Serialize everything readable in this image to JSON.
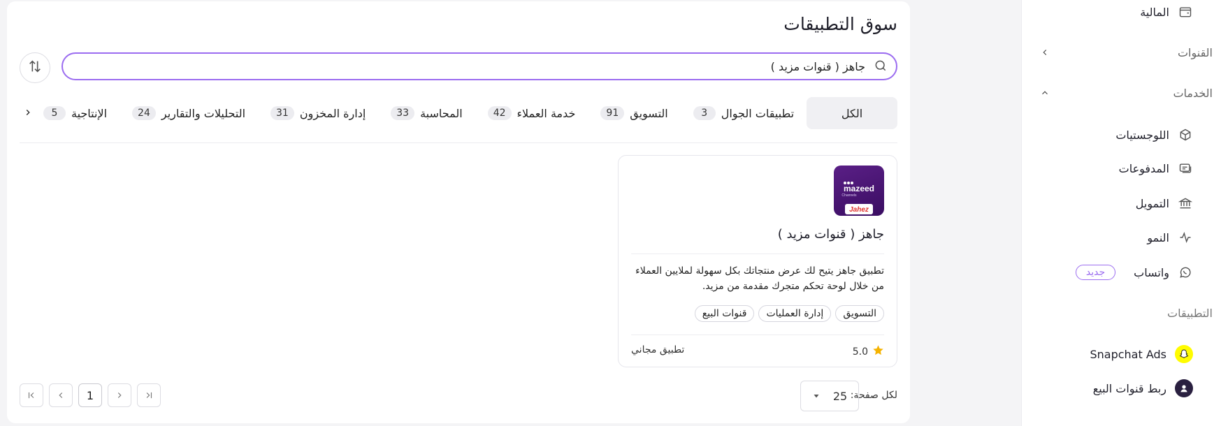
{
  "sidebar": {
    "finance": "المالية",
    "channels": "القنوات",
    "services": "الخدمات",
    "items": [
      {
        "label": "اللوجستيات",
        "icon": "box-icon"
      },
      {
        "label": "المدفوعات",
        "icon": "card-icon"
      },
      {
        "label": "التمويل",
        "icon": "bank-icon"
      },
      {
        "label": "النمو",
        "icon": "activity-icon"
      },
      {
        "label": "واتساب",
        "icon": "whatsapp-icon"
      }
    ],
    "new_badge": "جديد",
    "apps_section": "التطبيقات",
    "apps": [
      {
        "label": "Snapchat Ads",
        "icon": "snapchat-icon"
      },
      {
        "label": "ربط قنوات البيع",
        "icon": "sales-channel-icon"
      }
    ]
  },
  "main": {
    "title": "سوق التطبيقات",
    "search_value": "جاهز ( قنوات مزيد )",
    "categories": [
      {
        "label": "الكل",
        "count": ""
      },
      {
        "label": "تطبيقات الجوال",
        "count": "3"
      },
      {
        "label": "التسويق",
        "count": "91"
      },
      {
        "label": "خدمة العملاء",
        "count": "42"
      },
      {
        "label": "المحاسبة",
        "count": "33"
      },
      {
        "label": "إدارة المخزون",
        "count": "31"
      },
      {
        "label": "التحليلات والتقارير",
        "count": "24"
      },
      {
        "label": "الإنتاجية",
        "count": "5"
      }
    ],
    "app": {
      "name": "جاهز ( قنوات مزيد )",
      "logo_text": "mazeed",
      "logo_sub": "Channels",
      "logo_brand": "Jahez",
      "description": "تطبيق جاهز يتيح لك عرض منتجاتك بكل سهولة لملايين العملاء من خلال لوحة تحكم متجرك مقدمة من مزيد.",
      "tags": [
        "التسويق",
        "إدارة العمليات",
        "قنوات البيع"
      ],
      "rating": "5.0",
      "price": "تطبيق مجاني"
    },
    "footer": {
      "per_page_label": "لكل صفحة:",
      "per_page_value": "25",
      "current_page": "1"
    }
  },
  "colors": {
    "accent": "#9b6cf0",
    "star": "#f5b301",
    "logo_bg": "#4a1670",
    "brand_red": "#e0322d"
  }
}
